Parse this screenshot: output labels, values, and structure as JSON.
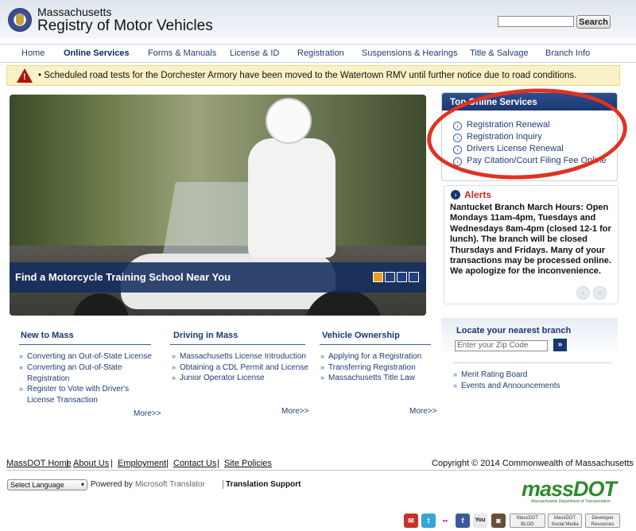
{
  "header": {
    "brand_top": "Massachusetts",
    "brand_main": "Registry of Motor Vehicles",
    "search_button": "Search"
  },
  "nav": {
    "items": [
      "Home",
      "Online Services",
      "Forms & Manuals",
      "License & ID",
      "Registration",
      "Suspensions & Hearings",
      "Title & Salvage",
      "Branch Info"
    ],
    "active": "Online Services"
  },
  "alert_bar": {
    "text": "Scheduled road tests for the Dorchester Armory have been moved to the Watertown RMV until further notice due to road conditions."
  },
  "hero": {
    "caption": "Find a Motorcycle Training School Near You",
    "slides": 4,
    "active_slide": 1
  },
  "top_services": {
    "title": "Top Online Services",
    "items": [
      "Registration Renewal",
      "Registration Inquiry",
      "Drivers License Renewal",
      "Pay Citation/Court Filing Fee Online"
    ]
  },
  "alerts": {
    "title": "Alerts",
    "body": "Nantucket Branch March Hours: Open Mondays 11am-4pm, Tuesdays and Wednesdays 8am-4pm (closed 12-1 for lunch). The branch will be closed Thursdays and Fridays. Many of your transactions may be processed online. We apologize for the inconvenience."
  },
  "columns": [
    {
      "title": "New to Mass",
      "links": [
        "Converting an Out-of-State License",
        "Converting an Out-of-State Registration",
        "Register to Vote with Driver's License Transaction"
      ],
      "more": "More>>"
    },
    {
      "title": "Driving in Mass",
      "links": [
        "Massachusetts License Introduction",
        "Obtaining a CDL Permit and License",
        "Junior Operator License"
      ],
      "more": "More>>"
    },
    {
      "title": "Vehicle Ownership",
      "links": [
        "Applying for a Registration",
        "Transferring Registration",
        "Massachusetts Title Law"
      ],
      "more": "More>>"
    }
  ],
  "locate": {
    "title": "Locate your nearest branch",
    "zip_placeholder": "Enter your Zip Code",
    "go_icon": "double-chevron-right"
  },
  "side_links": [
    "Merit Rating Board",
    "Events and Announcements"
  ],
  "footer": {
    "links": [
      "MassDOT Home",
      "About Us",
      "Employment",
      "Contact Us",
      "Site Policies"
    ],
    "copyright": "Copyright © 2014 Commonwealth of Massachusetts",
    "language_select": "Select Language",
    "powered_by": "Powered by",
    "translator": "Microsoft Translator",
    "translation_support": "Translation Support",
    "massdot_logo": "massDOT",
    "massdot_tagline": "Massachusetts Department of Transportation"
  },
  "social": [
    {
      "icon": "email-icon",
      "glyph": "✉",
      "color": "#c8312a"
    },
    {
      "icon": "twitter-icon",
      "glyph": "t",
      "color": "#3aa3d8"
    },
    {
      "icon": "flickr-icon",
      "glyph": "••",
      "color": "#ffffff"
    },
    {
      "icon": "facebook-icon",
      "glyph": "f",
      "color": "#3b5a9a"
    },
    {
      "icon": "youtube-icon",
      "glyph": "You",
      "color": "#e9e9e9"
    },
    {
      "icon": "instagram-icon",
      "glyph": "◙",
      "color": "#6b4e3a"
    }
  ],
  "social_wide": [
    "MassDOT BLOG",
    "MassDOT Social Media",
    "Developer Resources"
  ],
  "colors": {
    "brand_blue": "#1b3770",
    "alert_red": "#d02a1c",
    "highlight_ring": "#e23122",
    "massdot_green": "#2e8b2e"
  }
}
